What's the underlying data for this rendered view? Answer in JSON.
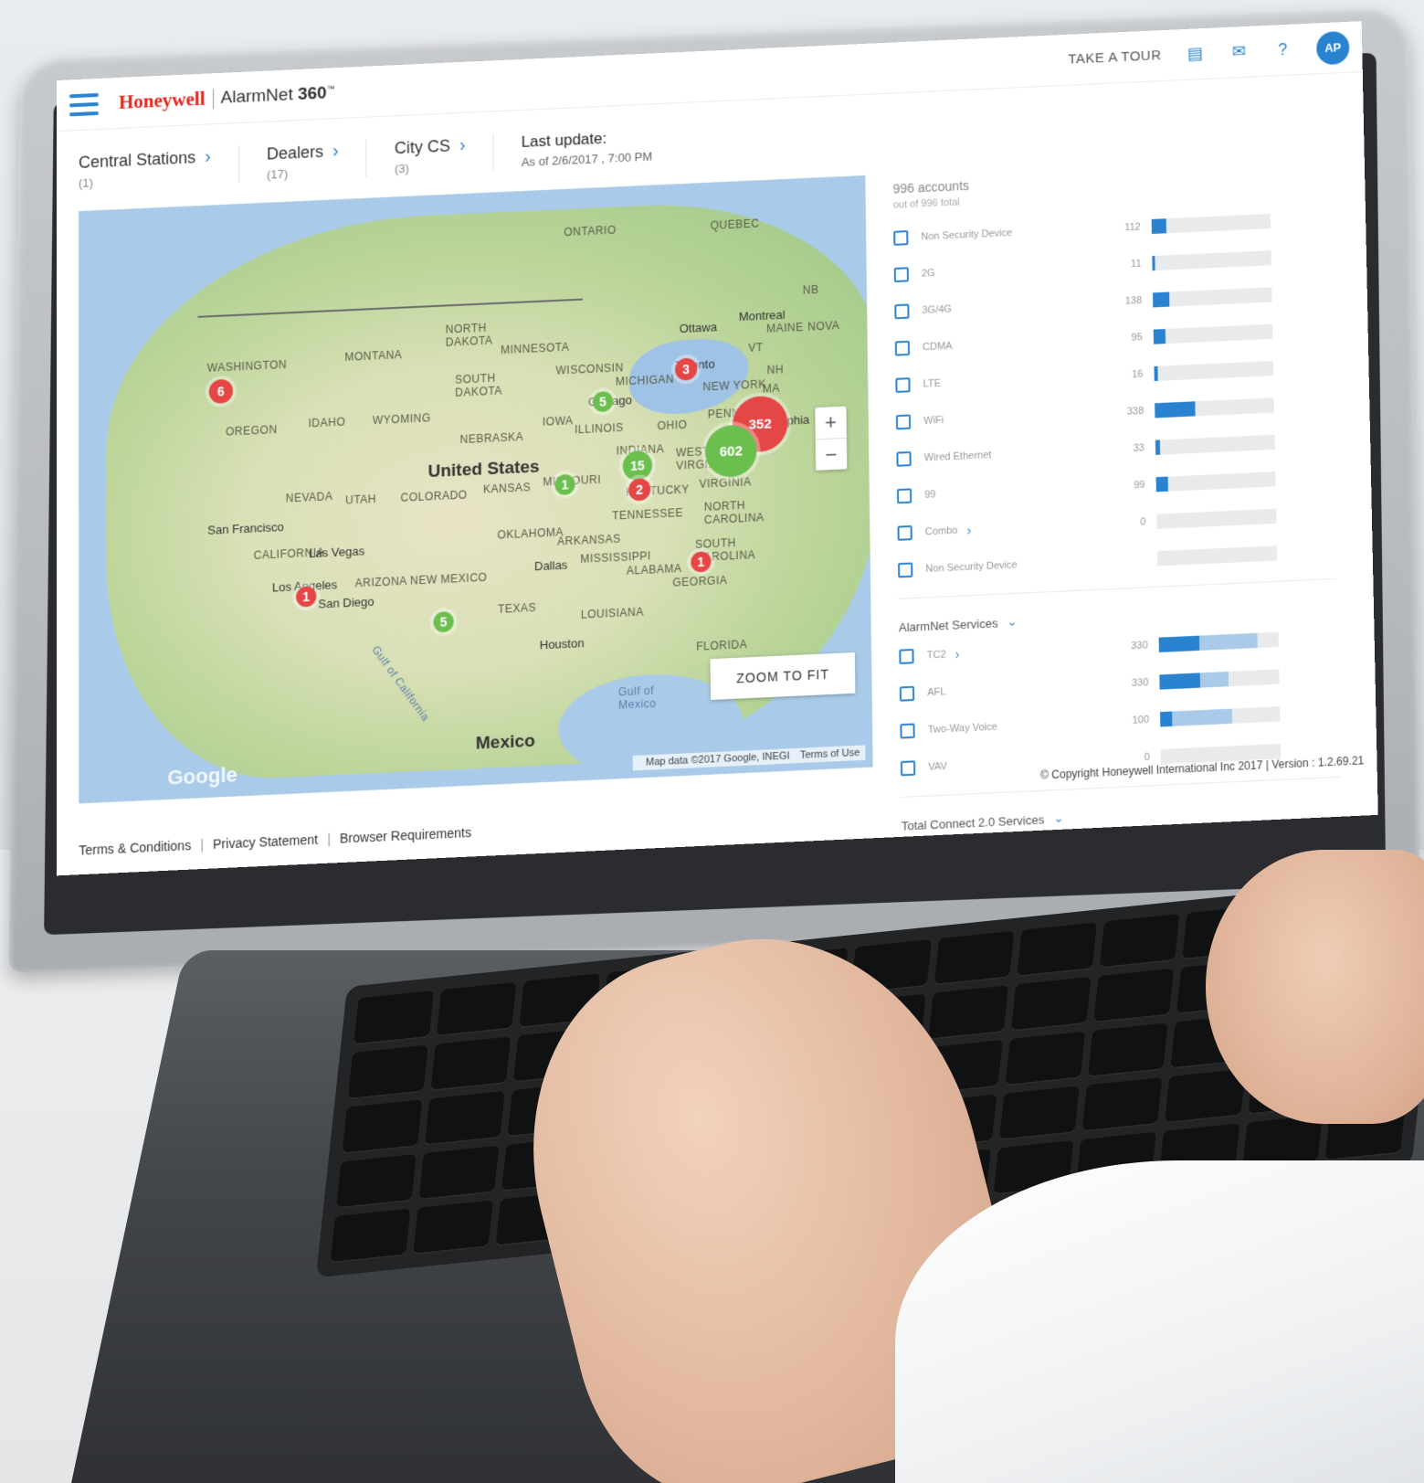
{
  "app": {
    "brand": "Honeywell",
    "product": "AlarmNet",
    "product_version": "360",
    "product_tm": "™"
  },
  "topbar": {
    "tour_label": "TAKE A TOUR",
    "avatar_initials": "AP",
    "icons": [
      "report-icon",
      "mail-icon",
      "help-icon"
    ]
  },
  "breadcrumbs": [
    {
      "label": "Central Stations",
      "count": "(1)"
    },
    {
      "label": "Dealers",
      "count": "(17)"
    },
    {
      "label": "City CS",
      "count": "(3)"
    }
  ],
  "last_update": {
    "title": "Last update:",
    "value": "As of 2/6/2017 , 7:00 PM"
  },
  "map": {
    "labels": {
      "ontario": "ONTARIO",
      "quebec": "QUEBEC",
      "north_dakota": "NORTH\nDAKOTA",
      "minnesota": "MINNESOTA",
      "montana": "MONTANA",
      "washington": "WASHINGTON",
      "oregon": "OREGON",
      "idaho": "IDAHO",
      "wyoming": "WYOMING",
      "south_dakota": "SOUTH\nDAKOTA",
      "wisconsin": "WISCONSIN",
      "michigan": "MICHIGAN",
      "iowa": "IOWA",
      "nebraska": "NEBRASKA",
      "illinois": "ILLINOIS",
      "ohio": "OHIO",
      "penn": "PENN",
      "nevada": "NEVADA",
      "utah": "UTAH",
      "colorado": "COLORADO",
      "kansas": "KANSAS",
      "missouri": "MISSOURI",
      "indiana": "INDIANA",
      "kentucky": "KENTUCKY",
      "west_virginia": "WEST\nVIRGINIA",
      "virginia": "VIRGINIA",
      "california": "CALIFORNIA",
      "arizona": "ARIZONA",
      "new_mexico": "NEW MEXICO",
      "oklahoma": "OKLAHOMA",
      "arkansas": "ARKANSAS",
      "tennessee": "TENNESSEE",
      "north_carolina": "NORTH\nCAROLINA",
      "south_carolina": "SOUTH\nCAROLINA",
      "mississippi": "MISSISSIPPI",
      "alabama": "ALABAMA",
      "georgia": "GEORGIA",
      "texas": "TEXAS",
      "louisiana": "LOUISIANA",
      "florida": "FLORIDA",
      "maine": "MAINE",
      "vt": "VT",
      "nh": "NH",
      "ma": "MA",
      "nb": "NB",
      "nova": "NOVA",
      "new_york": "NEW YORK",
      "united_states": "United States",
      "mexico": "Mexico",
      "gulf_california": "Gulf of California",
      "gulf_mexico": "Gulf of\nMexico"
    },
    "cities": {
      "ottawa": "Ottawa",
      "montreal": "Montreal",
      "toronto": "Toronto",
      "chicago": "Chicago",
      "philadelphia": "Philadelphia",
      "san_francisco": "San Francisco",
      "las_vegas": "Las Vegas",
      "los_angeles": "Los Angeles",
      "san_diego": "San Diego",
      "dallas": "Dallas",
      "houston": "Houston"
    },
    "markers": [
      {
        "label": "6",
        "status": "red"
      },
      {
        "label": "3",
        "status": "red"
      },
      {
        "label": "5",
        "status": "green"
      },
      {
        "label": "352",
        "status": "red"
      },
      {
        "label": "602",
        "status": "green"
      },
      {
        "label": "15",
        "status": "green"
      },
      {
        "label": "2",
        "status": "red"
      },
      {
        "label": "1",
        "status": "green"
      },
      {
        "label": "1",
        "status": "red"
      },
      {
        "label": "1",
        "status": "red"
      },
      {
        "label": "5",
        "status": "green"
      }
    ],
    "zoom_in": "+",
    "zoom_out": "−",
    "zoom_fit": "ZOOM TO FIT",
    "google": "Google",
    "attribution": "Map data ©2017 Google, INEGI",
    "terms": "Terms of Use"
  },
  "sidebar": {
    "accounts": "996 accounts",
    "accounts_sub": "out of 996 total",
    "filters": [
      {
        "label": "Non Security Device",
        "count": "112",
        "fill": 0.12,
        "chevron": false
      },
      {
        "label": "2G",
        "count": "11",
        "fill": 0.02,
        "chevron": false
      },
      {
        "label": "3G/4G",
        "count": "138",
        "fill": 0.14,
        "chevron": false
      },
      {
        "label": "CDMA",
        "count": "95",
        "fill": 0.1,
        "chevron": false
      },
      {
        "label": "LTE",
        "count": "16",
        "fill": 0.03,
        "chevron": false
      },
      {
        "label": "WiFi",
        "count": "338",
        "fill": 0.34,
        "chevron": false
      },
      {
        "label": "Wired Ethernet",
        "count": "33",
        "fill": 0.04,
        "chevron": false
      },
      {
        "label": "99",
        "count": "99",
        "fill": 0.1,
        "chevron": false
      },
      {
        "label": "Combo",
        "count": "0",
        "fill": 0,
        "chevron": true
      },
      {
        "label": "Non Security Device",
        "count": "",
        "fill": 0,
        "chevron": false
      }
    ],
    "services_title": "AlarmNet Services",
    "services": [
      {
        "label": "TC2",
        "count": "330",
        "fill": 0.34,
        "fill2": 0.82,
        "chevron": true
      },
      {
        "label": "AFL",
        "count": "330",
        "fill": 0.34,
        "fill2": 0.58,
        "chevron": false
      },
      {
        "label": "Two-Way Voice",
        "count": "100",
        "fill": 0.1,
        "fill2": 0.6,
        "chevron": false
      },
      {
        "label": "VAV",
        "count": "0",
        "fill": 0,
        "fill2": 0,
        "chevron": false
      }
    ],
    "total_title": "Total Connect 2.0 Services"
  },
  "footer": {
    "terms": "Terms & Conditions",
    "privacy": "Privacy Statement",
    "browser": "Browser Requirements",
    "copyright": "© Copyright Honeywell International Inc 2017 | Version : 1.2.69.21"
  },
  "colors": {
    "brand_red": "#e1261c",
    "accent_blue": "#2a83d0",
    "marker_red": "#e54646",
    "marker_green": "#6bbf4e"
  }
}
